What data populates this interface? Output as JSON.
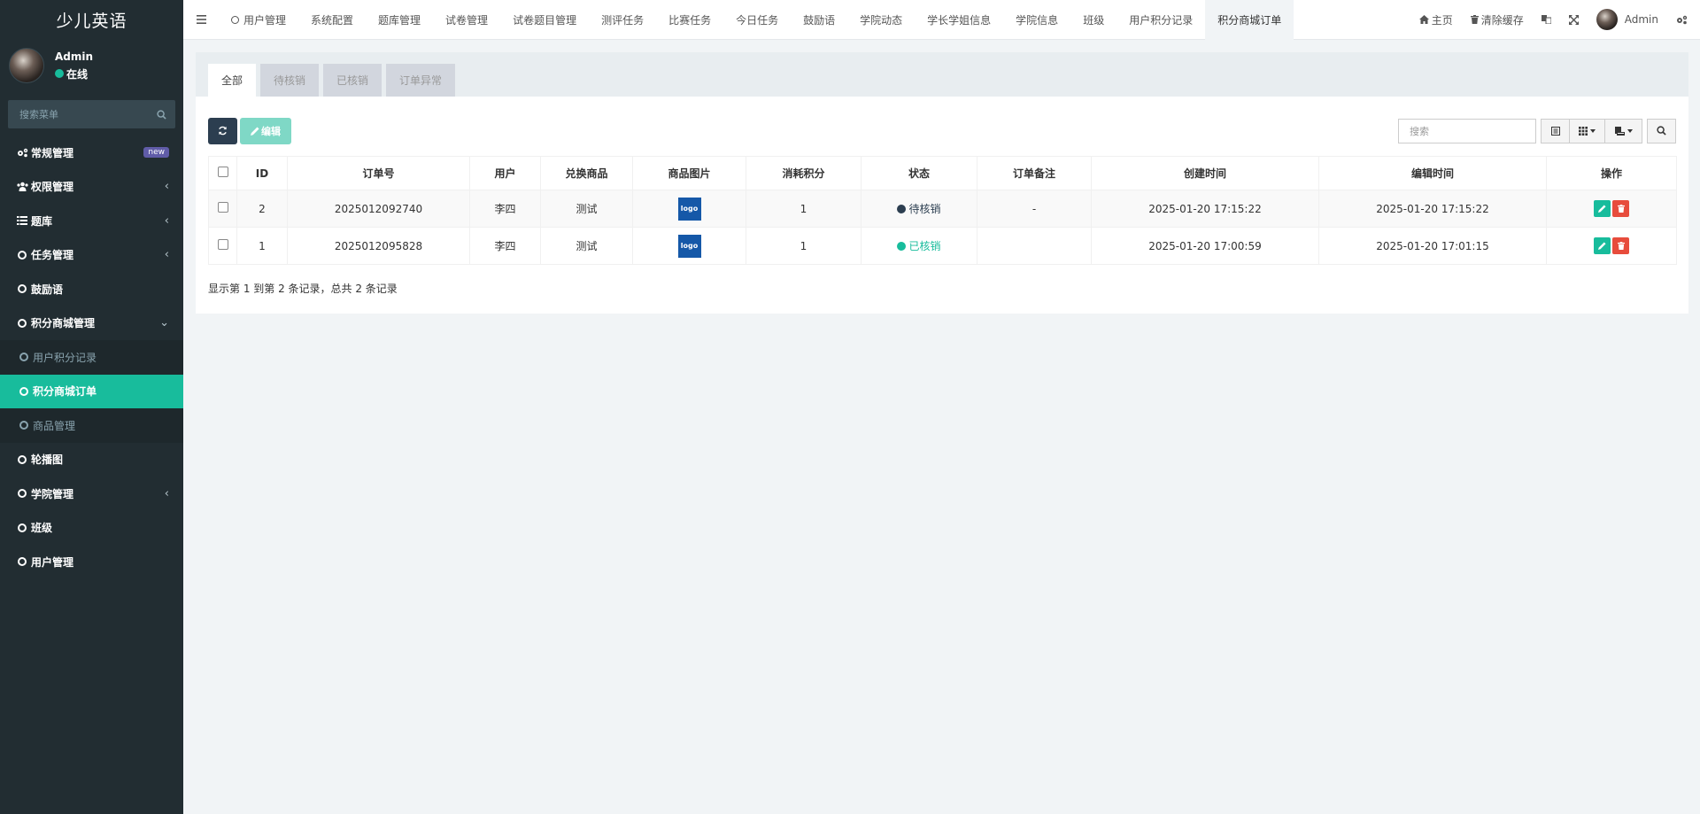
{
  "app": {
    "title": "少儿英语"
  },
  "user": {
    "name": "Admin",
    "status": "在线"
  },
  "sidebar": {
    "search_placeholder": "搜索菜单",
    "items": [
      {
        "label": "常规管理",
        "icon": "cogs-icon",
        "badge": "new"
      },
      {
        "label": "权限管理",
        "icon": "group-icon",
        "arrow": "‹"
      },
      {
        "label": "题库",
        "icon": "list-icon",
        "arrow": "‹"
      },
      {
        "label": "任务管理",
        "icon": "circle-icon",
        "arrow": "‹"
      },
      {
        "label": "鼓励语",
        "icon": "circle-icon"
      },
      {
        "label": "积分商城管理",
        "icon": "circle-icon",
        "arrow": "⌄"
      },
      {
        "label": "用户积分记录",
        "icon": "circle-icon"
      },
      {
        "label": "积分商城订单",
        "icon": "circle-icon"
      },
      {
        "label": "商品管理",
        "icon": "circle-icon"
      },
      {
        "label": "轮播图",
        "icon": "circle-icon"
      },
      {
        "label": "学院管理",
        "icon": "circle-icon",
        "arrow": "‹"
      },
      {
        "label": "班级",
        "icon": "circle-icon"
      },
      {
        "label": "用户管理",
        "icon": "circle-icon"
      }
    ]
  },
  "topbar": {
    "tabs": [
      "用户管理",
      "系统配置",
      "题库管理",
      "试卷管理",
      "试卷题目管理",
      "测评任务",
      "比赛任务",
      "今日任务",
      "鼓励语",
      "学院动态",
      "学长学姐信息",
      "学院信息",
      "班级",
      "用户积分记录",
      "积分商城订单"
    ],
    "home": "主页",
    "clear_cache": "清除缓存",
    "admin": "Admin"
  },
  "content": {
    "tabs": [
      "全部",
      "待核销",
      "已核销",
      "订单异常"
    ],
    "edit_label": "编辑",
    "search_placeholder": "搜索",
    "columns": [
      "ID",
      "订单号",
      "用户",
      "兑换商品",
      "商品图片",
      "消耗积分",
      "状态",
      "订单备注",
      "创建时间",
      "编辑时间",
      "操作"
    ],
    "rows": [
      {
        "id": "2",
        "order_no": "2025012092740",
        "user": "李四",
        "product": "测试",
        "image": "logo",
        "points": "1",
        "status": "待核销",
        "remark": "-",
        "created": "2025-01-20 17:15:22",
        "updated": "2025-01-20 17:15:22"
      },
      {
        "id": "1",
        "order_no": "2025012095828",
        "user": "李四",
        "product": "测试",
        "image": "logo",
        "points": "1",
        "status": "已核销",
        "remark": "",
        "created": "2025-01-20 17:00:59",
        "updated": "2025-01-20 17:01:15"
      }
    ],
    "summary": "显示第 1 到第 2 条记录，总共 2 条记录"
  },
  "colors": {
    "sidebar_bg": "#222d32",
    "accent": "#18bc9c",
    "dark_button": "#2c3e50",
    "danger": "#e74c3c",
    "new_badge": "#605ca8"
  }
}
